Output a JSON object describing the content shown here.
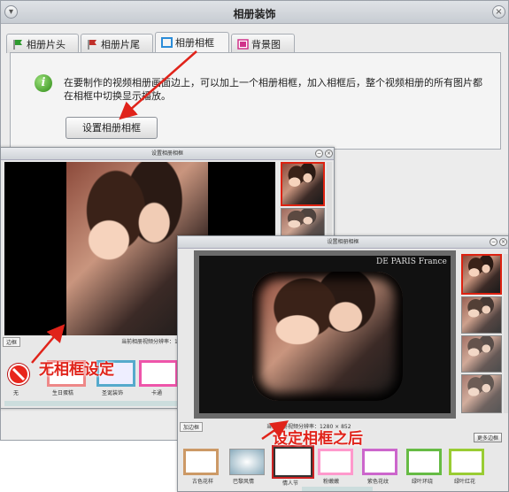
{
  "window": {
    "title": "相册装饰"
  },
  "tabs": [
    {
      "label": "相册片头",
      "color": "#2e9a2e"
    },
    {
      "label": "相册片尾",
      "color": "#c0302a"
    },
    {
      "label": "相册相框",
      "color": "#2b8cd8"
    },
    {
      "label": "背景图",
      "color": "#d0338a"
    }
  ],
  "panel": {
    "description": "在要制作的视频相册画面边上，可以加上一个相册相框，加入相框后，整个视频相册的所有图片都在相框中切换显示播放。",
    "button": "设置相册相框"
  },
  "sub1": {
    "title": "设置相册相框",
    "border_tab": "边框",
    "resolution": "当前相册视频分辨率：1280 × 852",
    "frames": [
      "无",
      "生日蛋糕",
      "圣诞装饰",
      "卡通"
    ]
  },
  "sub2": {
    "title": "设置相册相框",
    "overlay_text": "DE PARIS France",
    "border_tab": "加边框",
    "resolution": "当前相册视频分辨率：1280 × 852",
    "more_button": "更多边框",
    "frames": [
      "古色花样",
      "巴黎风情",
      "情人节",
      "粉嫩嫩",
      "紫色花纹",
      "绿叶环绕",
      "绿叶红花"
    ]
  },
  "annotations": {
    "no_frame": "无相框设定",
    "after_frame": "设定相框之后"
  },
  "colors": {
    "annotation": "#e0231a",
    "arrow": "#e0231a"
  }
}
